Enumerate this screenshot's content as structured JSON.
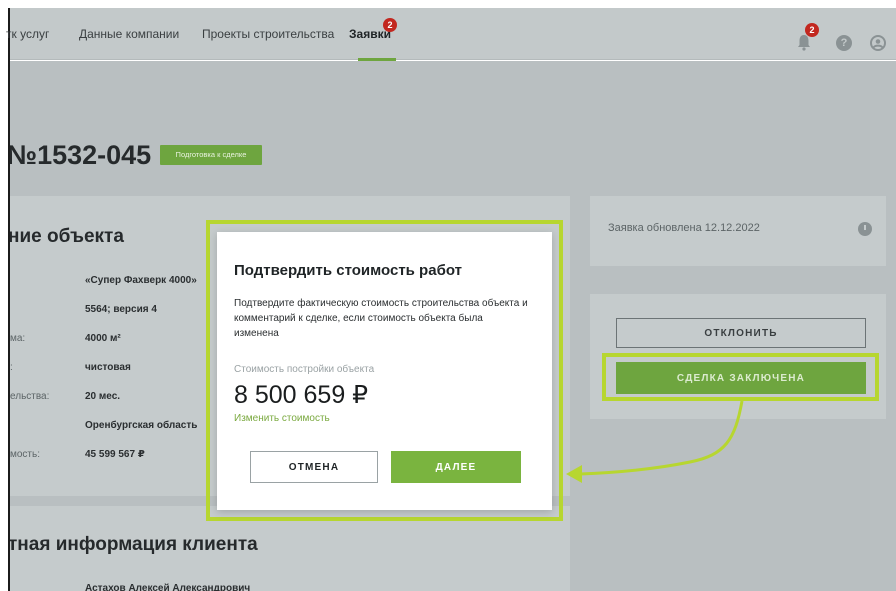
{
  "navbar": {
    "items": [
      {
        "label": "тк услуг"
      },
      {
        "label": "Данные компании"
      },
      {
        "label": "Проекты строительства"
      },
      {
        "label": "Заявки",
        "badge": "2"
      }
    ],
    "notifications_badge": "2",
    "help_icon": "?"
  },
  "request": {
    "title": "№1532-045",
    "status": "Подготовка к сделке"
  },
  "object_card": {
    "title": "ние объекта",
    "rows": [
      {
        "label": "",
        "value": "«Супер Фахверк 4000»"
      },
      {
        "label": "",
        "value": "5564; версия 4"
      },
      {
        "label": "ма:",
        "value": "4000 м²"
      },
      {
        "label": ":",
        "value": "чистовая"
      },
      {
        "label": "ельства:",
        "value": "20 мес."
      },
      {
        "label": "",
        "value": "Оренбургская область"
      },
      {
        "label": "мость:",
        "value": "45 599 567 ₽"
      }
    ]
  },
  "client_card": {
    "title": "тная информация клиента",
    "name": "Астахов Алексей Александрович"
  },
  "update_card": {
    "text": "Заявка обновлена 12.12.2022"
  },
  "actions": {
    "reject_label": "ОТКЛОНИТЬ",
    "deal_label": "СДЕЛКА ЗАКЛЮЧЕНА"
  },
  "modal": {
    "title": "Подтвердить стоимость работ",
    "description": "Подтвердите фактическую стоимость строительства объекта и комментарий к сделке, если стоимость объекта была изменена",
    "cost_label": "Стоимость постройки объекта",
    "cost_value": "8 500 659 ₽",
    "change_link": "Изменить стоимость",
    "cancel_label": "ОТМЕНА",
    "next_label": "ДАЛЕЕ"
  },
  "colors": {
    "accent_green": "#6ea53f",
    "highlight": "#b7d630",
    "badge_red": "#c2271f"
  },
  "icons": [
    "bell-icon",
    "help-icon",
    "user-icon",
    "clock-icon"
  ]
}
